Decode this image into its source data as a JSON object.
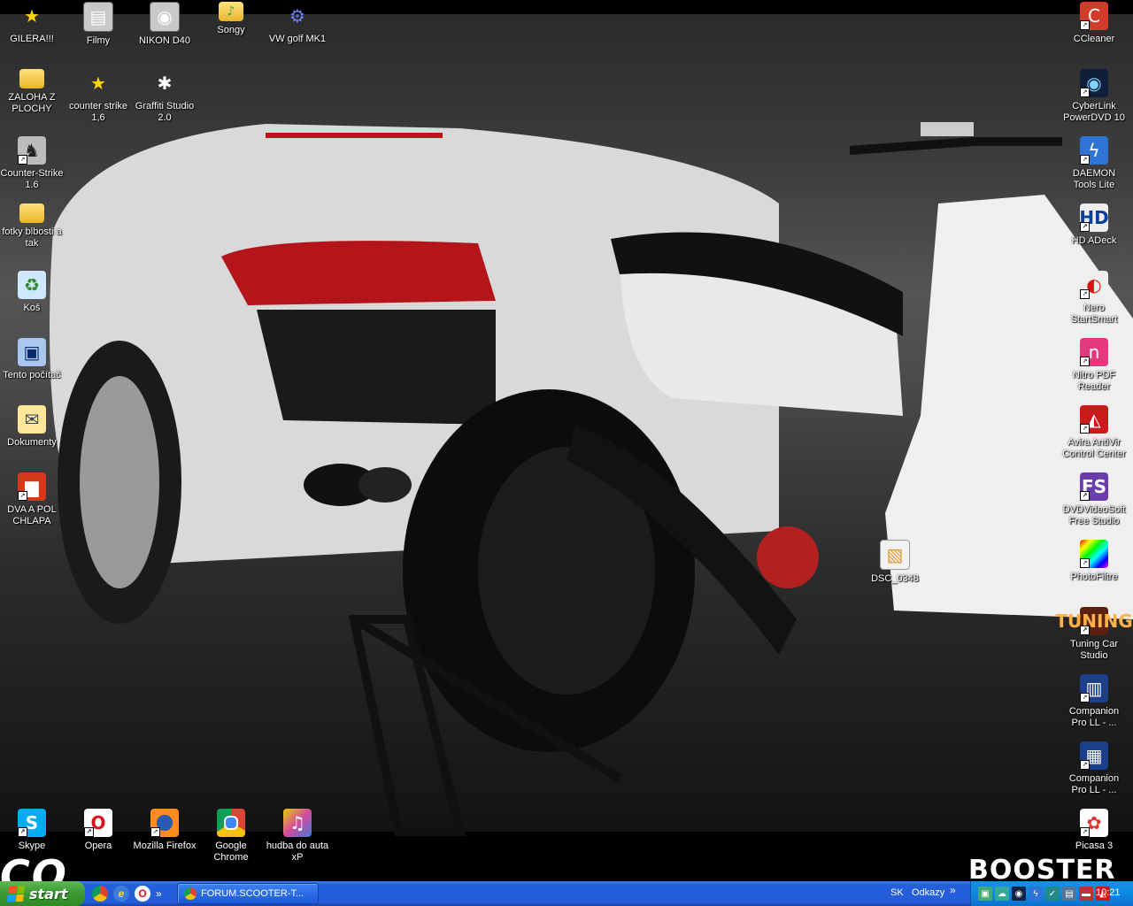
{
  "desktop": {
    "icons": [
      {
        "label": "GILERA!!!",
        "glyph": "★",
        "icon": "star-icon"
      },
      {
        "label": "Filmy",
        "glyph": "▤",
        "icon": "film-folder-icon"
      },
      {
        "label": "NIKON D40",
        "glyph": "◉",
        "icon": "camera-icon"
      },
      {
        "label": "Songy",
        "glyph": "♪",
        "icon": "music-folder-icon"
      },
      {
        "label": "VW golf MK1",
        "glyph": "⚙",
        "icon": "gear-icon"
      },
      {
        "label": "ZALOHA Z PLOCHY",
        "glyph": "",
        "icon": "folder-icon"
      },
      {
        "label": "counter strike 1,6",
        "glyph": "★",
        "icon": "star-icon"
      },
      {
        "label": "Graffiti Studio 2.0",
        "glyph": "✱",
        "icon": "spray-icon"
      },
      {
        "label": "Counter-Strike 1.6",
        "glyph": "♞",
        "icon": "counter-strike-icon"
      },
      {
        "label": "fotky blbosti a tak",
        "glyph": "",
        "icon": "folder-icon"
      },
      {
        "label": "Koš",
        "glyph": "♻",
        "icon": "recycle-bin-icon"
      },
      {
        "label": "Tento počítač",
        "glyph": "▣",
        "icon": "computer-icon"
      },
      {
        "label": "Dokumenty",
        "glyph": "✉",
        "icon": "documents-icon"
      },
      {
        "label": "DVA A POL CHLAPA",
        "glyph": "▆",
        "icon": "video-file-icon"
      },
      {
        "label": "CCleaner",
        "glyph": "C",
        "icon": "ccleaner-icon"
      },
      {
        "label": "CyberLink PowerDVD 10",
        "glyph": "◉",
        "icon": "cyberlink-icon"
      },
      {
        "label": "DAEMON Tools Lite",
        "glyph": "ϟ",
        "icon": "daemon-tools-icon"
      },
      {
        "label": "HD ADeck",
        "glyph": "HD",
        "icon": "hd-adeck-icon"
      },
      {
        "label": "Nero StartSmart",
        "glyph": "◐",
        "icon": "nero-icon"
      },
      {
        "label": "Nitro PDF Reader",
        "glyph": "n",
        "icon": "nitro-pdf-icon"
      },
      {
        "label": "Avira AntiVir Control Center",
        "glyph": "◭",
        "icon": "avira-icon"
      },
      {
        "label": "DVDVideoSoft Free Studio",
        "glyph": "FS",
        "icon": "free-studio-icon"
      },
      {
        "label": "PhotoFiltre",
        "glyph": "",
        "icon": "photofiltre-icon"
      },
      {
        "label": "Tuning Car Studio",
        "glyph": "TUNING",
        "icon": "tuning-car-icon"
      },
      {
        "label": "Companion Pro LL - ...",
        "glyph": "▥",
        "icon": "companion-icon"
      },
      {
        "label": "Companion Pro LL - ...",
        "glyph": "▦",
        "icon": "companion-icon"
      },
      {
        "label": "Picasa 3",
        "glyph": "✿",
        "icon": "picasa-icon"
      },
      {
        "label": "Skype",
        "glyph": "S",
        "icon": "skype-icon"
      },
      {
        "label": "Opera",
        "glyph": "O",
        "icon": "opera-icon"
      },
      {
        "label": "Mozilla Firefox",
        "glyph": "",
        "icon": "firefox-icon"
      },
      {
        "label": "Google Chrome",
        "glyph": "",
        "icon": "chrome-icon"
      },
      {
        "label": "hudba do auta xP",
        "glyph": "♫",
        "icon": "winrar-icon"
      },
      {
        "label": "DSC_0348",
        "glyph": "▧",
        "icon": "image-file-icon"
      }
    ],
    "wallpaper": {
      "brand_left": "CO",
      "brand_right": "BOOSTER"
    }
  },
  "taskbar": {
    "start_label": "start",
    "quicklaunch": [
      {
        "glyph": "",
        "icon": "chrome-icon"
      },
      {
        "glyph": "e",
        "icon": "internet-explorer-icon"
      },
      {
        "glyph": "O",
        "icon": "opera-icon"
      }
    ],
    "quicklaunch_more": "»",
    "task": {
      "label": "FORUM.SCOOTER-T..."
    },
    "language": "SK",
    "links_label": "Odkazy",
    "links_more": "»",
    "tray_icons": [
      {
        "glyph": "▣",
        "icon": "network-icon",
        "color": "#4a7"
      },
      {
        "glyph": "☁",
        "icon": "messenger-icon",
        "color": "#3a9"
      },
      {
        "glyph": "◉",
        "icon": "cyberlink-tray-icon",
        "color": "#124"
      },
      {
        "glyph": "ϟ",
        "icon": "daemon-tray-icon",
        "color": "#2e74d6"
      },
      {
        "glyph": "✓",
        "icon": "security-icon",
        "color": "#288"
      },
      {
        "glyph": "▤",
        "icon": "speaker-icon",
        "color": "#579"
      },
      {
        "glyph": "▬",
        "icon": "safely-remove-icon",
        "color": "#b33"
      },
      {
        "glyph": "◭",
        "icon": "avira-tray-icon",
        "color": "#c91b1b"
      }
    ],
    "clock": "10:21"
  }
}
